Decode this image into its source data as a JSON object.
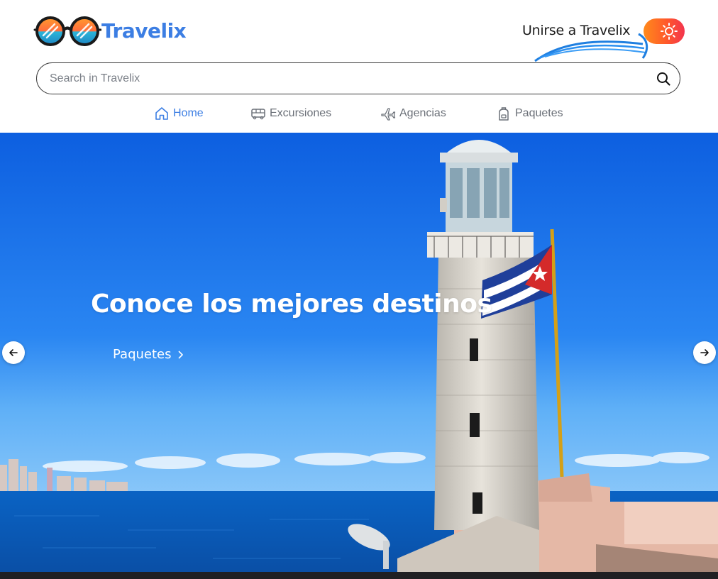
{
  "brand": {
    "name": "Travelix"
  },
  "header": {
    "join_label": "Unirse a Travelix",
    "theme_toggle_icon": "sun-icon"
  },
  "search": {
    "placeholder": "Search in Travelix",
    "value": "",
    "icon": "search-icon"
  },
  "nav": {
    "items": [
      {
        "label": "Home",
        "icon": "home-icon",
        "active": true
      },
      {
        "label": "Excursiones",
        "icon": "bus-icon",
        "active": false
      },
      {
        "label": "Agencias",
        "icon": "plane-icon",
        "active": false
      },
      {
        "label": "Paquetes",
        "icon": "backpack-icon",
        "active": false
      }
    ]
  },
  "hero": {
    "title": "Conoce los mejores destinos",
    "link_label": "Paquetes",
    "prev_icon": "arrow-left-icon",
    "next_icon": "arrow-right-icon",
    "image": "lighthouse-with-cuban-flag-by-the-sea"
  },
  "colors": {
    "brand_blue": "#3c7ee3",
    "toggle_orange": "#ff8a1c",
    "toggle_red": "#f3344e",
    "nav_text": "#6b7078"
  }
}
